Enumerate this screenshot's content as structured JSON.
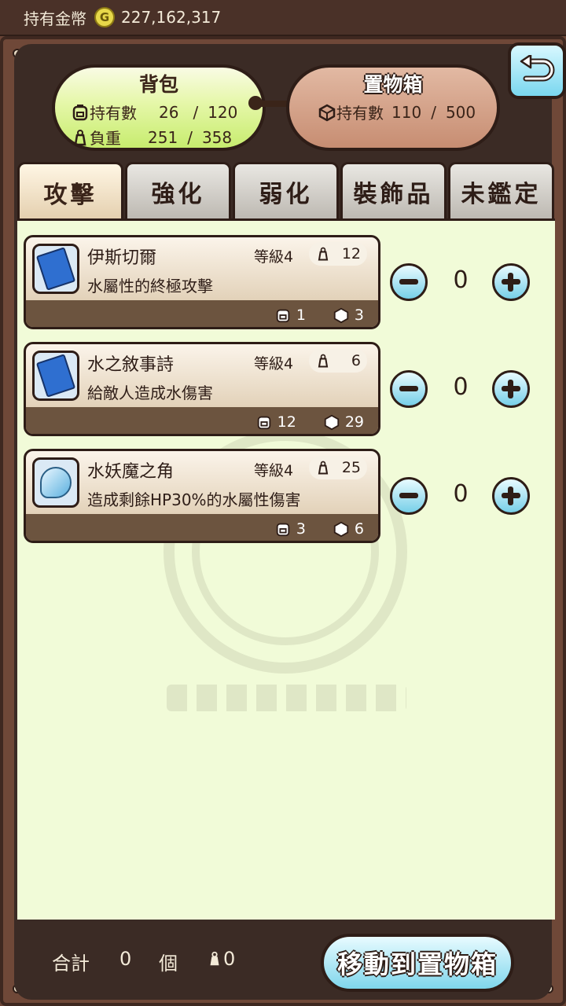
{
  "topbar": {
    "label": "持有金幣",
    "coin_symbol": "G",
    "amount": "227,162,317"
  },
  "bag": {
    "title": "背包",
    "count_label": "持有數",
    "count": "26",
    "count_max": "120",
    "weight_label": "負重",
    "weight": "251",
    "weight_max": "358",
    "sep": "/"
  },
  "storage": {
    "title": "置物箱",
    "count_label": "持有數",
    "count": "110",
    "count_max": "500",
    "sep": "/"
  },
  "tabs": [
    {
      "label": "攻擊",
      "active": true
    },
    {
      "label": "強化",
      "active": false
    },
    {
      "label": "弱化",
      "active": false
    },
    {
      "label": "裝飾品",
      "active": false
    },
    {
      "label": "未鑑定",
      "active": false
    }
  ],
  "items": [
    {
      "name": "伊斯切爾",
      "level": "等級4",
      "weight": "12",
      "desc": "水屬性的終極攻擊",
      "bag_count": "1",
      "box_count": "3",
      "qty": "0",
      "icon": "book-icon"
    },
    {
      "name": "水之敘事詩",
      "level": "等級4",
      "weight": "6",
      "desc": "給敵人造成水傷害",
      "bag_count": "12",
      "box_count": "29",
      "qty": "0",
      "icon": "book-icon"
    },
    {
      "name": "水妖魔之角",
      "level": "等級4",
      "weight": "25",
      "desc": "造成剩餘HP30%的水屬性傷害",
      "bag_count": "3",
      "box_count": "6",
      "qty": "0",
      "icon": "horn-icon"
    }
  ],
  "footer": {
    "total_label": "合計",
    "total_value": "0",
    "unit": "個",
    "weight_value": "0",
    "move_button": "移動到置物箱"
  },
  "colors": {
    "accent": "#7fd6ec",
    "frame": "#6f4838",
    "panel": "#f1fbd8"
  }
}
